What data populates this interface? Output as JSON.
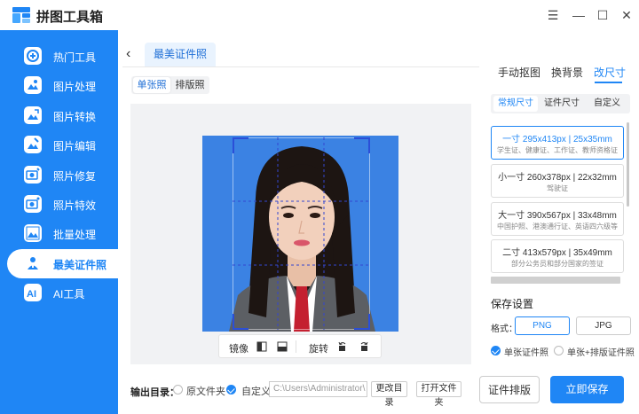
{
  "app": {
    "title": "拼图工具箱"
  },
  "window_controls": {
    "menu": "☰",
    "minimize": "—",
    "maximize": "☐",
    "close": "✕"
  },
  "sidebar": {
    "items": [
      {
        "label": "热门工具",
        "icon": "hot-tools-icon"
      },
      {
        "label": "图片处理",
        "icon": "image-process-icon"
      },
      {
        "label": "图片转换",
        "icon": "image-convert-icon"
      },
      {
        "label": "图片编辑",
        "icon": "image-edit-icon"
      },
      {
        "label": "照片修复",
        "icon": "photo-repair-icon"
      },
      {
        "label": "照片特效",
        "icon": "photo-effects-icon"
      },
      {
        "label": "批量处理",
        "icon": "batch-process-icon"
      },
      {
        "label": "最美证件照",
        "icon": "id-photo-icon",
        "active": true
      },
      {
        "label": "AI工具",
        "icon": "ai-tools-icon"
      }
    ],
    "color": "#1f86f5"
  },
  "header": {
    "back": "‹",
    "tab": "最美证件照"
  },
  "mode": {
    "single": "单张照",
    "layout": "排版照",
    "selected": "single"
  },
  "toolbar": {
    "mirror": "镜像",
    "rotate": "旋转"
  },
  "output": {
    "label": "输出目录：",
    "original_folder": "原文件夹",
    "custom": "自定义",
    "path": "C:\\Users\\Administrator\\",
    "change_dir": "更改目录",
    "open_folder": "打开文件夹",
    "selected": "custom"
  },
  "right_panel": {
    "tabs": [
      "手动抠图",
      "换背景",
      "改尺寸"
    ],
    "selected_tab": "改尺寸",
    "sub_tabs": [
      "常规尺寸",
      "证件尺寸",
      "自定义"
    ],
    "selected_sub_tab": "常规尺寸",
    "sizes": [
      {
        "main": "一寸 295x413px | 25x35mm",
        "sub": "学生证、健康证、工作证、教师资格证"
      },
      {
        "main": "小一寸 260x378px | 22x32mm",
        "sub": "驾驶证"
      },
      {
        "main": "大一寸 390x567px | 33x48mm",
        "sub": "中国护照、港澳通行证、英语四六级等"
      },
      {
        "main": "二寸 413x579px | 35x49mm",
        "sub": "部分公务员和部分国家的签证"
      }
    ],
    "save_settings": "保存设置",
    "format_label": "格式：",
    "formats": [
      "PNG",
      "JPG"
    ],
    "selected_format": "PNG",
    "save_single": "单张证件照",
    "save_single_layout": "单张+排版证件照",
    "layout_button": "证件排版",
    "save_button": "立即保存",
    "accent": "#1f86f5"
  }
}
